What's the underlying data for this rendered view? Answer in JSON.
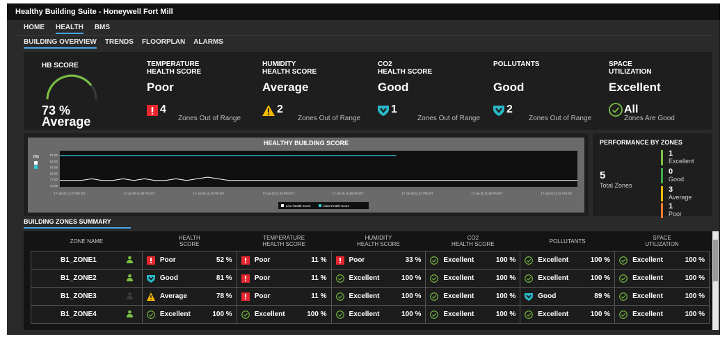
{
  "app": {
    "title": "Healthy Building Suite - Honeywell Fort Mill"
  },
  "nav": {
    "primary": [
      "HOME",
      "HEALTH",
      "BMS"
    ],
    "primary_active": "HEALTH",
    "secondary": [
      "BUILDING OVERVIEW",
      "TRENDS",
      "FLOORPLAN",
      "ALARMS"
    ],
    "secondary_active": "BUILDING OVERVIEW"
  },
  "hb_score": {
    "label": "HB SCORE",
    "value": "73 %",
    "rating": "Average"
  },
  "kpis": [
    {
      "label_1": "TEMPERATURE",
      "label_2": "HEALTH SCORE",
      "status": "Poor",
      "count": "4",
      "desc": "Zones Out of Range",
      "icon": "poor-alert-icon",
      "color": "#e8262f"
    },
    {
      "label_1": "HUMIDITY",
      "label_2": "HEALTH SCORE",
      "status": "Average",
      "count": "2",
      "desc": "Zones Out of Range",
      "icon": "average-warning-icon",
      "color": "#f5b800"
    },
    {
      "label_1": "CO2",
      "label_2": "HEALTH SCORE",
      "status": "Good",
      "count": "1",
      "desc": "Zones Out of Range",
      "icon": "good-shield-icon",
      "color": "#2ab8c8"
    },
    {
      "label_1": "POLLUTANTS",
      "label_2": "",
      "status": "Good",
      "count": "2",
      "desc": "Zones Out of Range",
      "icon": "good-shield-icon",
      "color": "#2ab8c8"
    },
    {
      "label_1": "SPACE",
      "label_2": "UTILIZATION",
      "status": "Excellent",
      "count": "All",
      "desc": "Zones Are Good",
      "icon": "excellent-check-icon",
      "color": "#7bc142"
    }
  ],
  "chart_data": {
    "type": "line",
    "title": "HEALTHY BUILDING SCORE",
    "ylabel": "(%)",
    "yticks": [
      "87.00",
      "82.00",
      "87.00",
      "82.00",
      "77.00",
      "72.00"
    ],
    "xticks": [
      "17-Jul-20 11:37 PM IST",
      "17-Jul-20 11:39 PM IST",
      "17-Jul-20 11:41 PM IST",
      "17-Jul-20 11:43 PM IST",
      "17-Jul-20 11:45 PM IST",
      "17-Jul-20 11:47 PM IST",
      "17-Jul-20 11:49 PM IST",
      "17-Jul-20 11:51 PM IST"
    ],
    "series": [
      {
        "name": "Live Health Score",
        "color": "#ffffff",
        "values": [
          73,
          73,
          73,
          74,
          73,
          73,
          74,
          73,
          74,
          73,
          73,
          74,
          73,
          74,
          75,
          74,
          73,
          73,
          73,
          73,
          73,
          73,
          73,
          73,
          73,
          73,
          73,
          73,
          73,
          73,
          73,
          73,
          73,
          73,
          73,
          73,
          73,
          73,
          73,
          73,
          73,
          73,
          73,
          73,
          73,
          73,
          73,
          73,
          73,
          73
        ]
      },
      {
        "name": "Ideal Health Score",
        "color": "#2ad0d8",
        "values": [
          88,
          88,
          88,
          88,
          88,
          88,
          88,
          88,
          88,
          88,
          88,
          88,
          88,
          88,
          88,
          88,
          88,
          88,
          88,
          88,
          88,
          88,
          88,
          88,
          88,
          88,
          88,
          88,
          88,
          88,
          88,
          88,
          88,
          88,
          88,
          88,
          88,
          88,
          88,
          88
        ]
      }
    ],
    "ylim": [
      70,
      90
    ],
    "legend": "bottom-center"
  },
  "performance": {
    "title": "PERFORMANCE BY ZONES",
    "total": "5",
    "total_label": "Total Zones",
    "items": [
      {
        "num": "1",
        "label": "Excellent",
        "color": "#7bc142"
      },
      {
        "num": "0",
        "label": "Good",
        "color": "#3fae49"
      },
      {
        "num": "3",
        "label": "Average",
        "color": "#f5b800"
      },
      {
        "num": "1",
        "label": "Poor",
        "color": "#f07a2a"
      }
    ]
  },
  "summary": {
    "title": "BUILDING ZONES SUMMARY",
    "headers": [
      {
        "l1": "ZONE NAME",
        "l2": ""
      },
      {
        "l1": "HEALTH",
        "l2": "SCORE"
      },
      {
        "l1": "TEMPERATURE",
        "l2": "HEALTH SCORE"
      },
      {
        "l1": "HUMIDITY",
        "l2": "HEALTH SCORE"
      },
      {
        "l1": "CO2",
        "l2": "HEALTH SCORE"
      },
      {
        "l1": "POLLUTANTS",
        "l2": ""
      },
      {
        "l1": "SPACE",
        "l2": "UTILIZATION"
      }
    ],
    "rows": [
      {
        "zone": "B1_ZONE1",
        "occupied": true,
        "cells": [
          {
            "status": "Poor",
            "value": "52 %"
          },
          {
            "status": "Poor",
            "value": "11 %"
          },
          {
            "status": "Poor",
            "value": "33 %"
          },
          {
            "status": "Excellent",
            "value": "100 %"
          },
          {
            "status": "Excellent",
            "value": "100 %"
          },
          {
            "status": "Excellent",
            "value": "100 %"
          }
        ]
      },
      {
        "zone": "B1_ZONE2",
        "occupied": true,
        "cells": [
          {
            "status": "Good",
            "value": "81 %"
          },
          {
            "status": "Poor",
            "value": "11 %"
          },
          {
            "status": "Excellent",
            "value": "100 %"
          },
          {
            "status": "Excellent",
            "value": "100 %"
          },
          {
            "status": "Excellent",
            "value": "100 %"
          },
          {
            "status": "Excellent",
            "value": "100 %"
          }
        ]
      },
      {
        "zone": "B1_ZONE3",
        "occupied": false,
        "cells": [
          {
            "status": "Average",
            "value": "78 %"
          },
          {
            "status": "Poor",
            "value": "11 %"
          },
          {
            "status": "Excellent",
            "value": "100 %"
          },
          {
            "status": "Excellent",
            "value": "100 %"
          },
          {
            "status": "Good",
            "value": "89 %"
          },
          {
            "status": "Excellent",
            "value": "100 %"
          }
        ]
      },
      {
        "zone": "B1_ZONE4",
        "occupied": true,
        "cells": [
          {
            "status": "Excellent",
            "value": "100 %"
          },
          {
            "status": "Excellent",
            "value": "100 %"
          },
          {
            "status": "Excellent",
            "value": "100 %"
          },
          {
            "status": "Excellent",
            "value": "100 %"
          },
          {
            "status": "Excellent",
            "value": "100 %"
          },
          {
            "status": "Excellent",
            "value": "100 %"
          }
        ]
      }
    ]
  },
  "colors": {
    "accent": "#44a7e8",
    "poor": "#e8262f",
    "average": "#f5b800",
    "good": "#2ab8c8",
    "excellent": "#7bc142",
    "occupied": "#7bc142"
  }
}
